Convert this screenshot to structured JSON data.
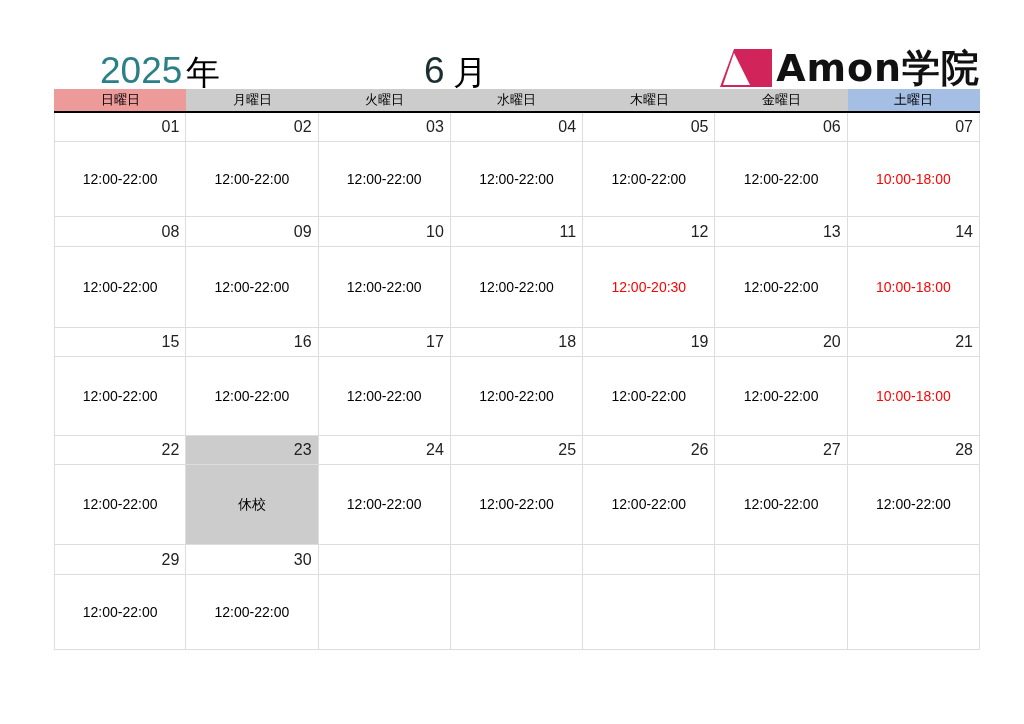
{
  "title": {
    "year": "2025",
    "year_unit": "年",
    "month": "6",
    "month_unit": "月"
  },
  "logo": {
    "text": "Amon学院"
  },
  "weekdays": [
    {
      "label": "日曜日",
      "color": "#ec9a9a"
    },
    {
      "label": "月曜日",
      "color": "#cccccc"
    },
    {
      "label": "火曜日",
      "color": "#cccccc"
    },
    {
      "label": "水曜日",
      "color": "#cccccc"
    },
    {
      "label": "木曜日",
      "color": "#cccccc"
    },
    {
      "label": "金曜日",
      "color": "#cccccc"
    },
    {
      "label": "土曜日",
      "color": "#a4bee4"
    }
  ],
  "weeks": [
    [
      {
        "date": "01",
        "hours": "12:00-22:00",
        "color": "#000000",
        "closed": false
      },
      {
        "date": "02",
        "hours": "12:00-22:00",
        "color": "#000000",
        "closed": false
      },
      {
        "date": "03",
        "hours": "12:00-22:00",
        "color": "#000000",
        "closed": false
      },
      {
        "date": "04",
        "hours": "12:00-22:00",
        "color": "#000000",
        "closed": false
      },
      {
        "date": "05",
        "hours": "12:00-22:00",
        "color": "#000000",
        "closed": false
      },
      {
        "date": "06",
        "hours": "12:00-22:00",
        "color": "#000000",
        "closed": false
      },
      {
        "date": "07",
        "hours": "10:00-18:00",
        "color": "#ff0000",
        "closed": false
      }
    ],
    [
      {
        "date": "08",
        "hours": "12:00-22:00",
        "color": "#000000",
        "closed": false
      },
      {
        "date": "09",
        "hours": "12:00-22:00",
        "color": "#000000",
        "closed": false
      },
      {
        "date": "10",
        "hours": "12:00-22:00",
        "color": "#000000",
        "closed": false
      },
      {
        "date": "11",
        "hours": "12:00-22:00",
        "color": "#000000",
        "closed": false
      },
      {
        "date": "12",
        "hours": "12:00-20:30",
        "color": "#ff0000",
        "closed": false
      },
      {
        "date": "13",
        "hours": "12:00-22:00",
        "color": "#000000",
        "closed": false
      },
      {
        "date": "14",
        "hours": "10:00-18:00",
        "color": "#ff0000",
        "closed": false
      }
    ],
    [
      {
        "date": "15",
        "hours": "12:00-22:00",
        "color": "#000000",
        "closed": false
      },
      {
        "date": "16",
        "hours": "12:00-22:00",
        "color": "#000000",
        "closed": false
      },
      {
        "date": "17",
        "hours": "12:00-22:00",
        "color": "#000000",
        "closed": false
      },
      {
        "date": "18",
        "hours": "12:00-22:00",
        "color": "#000000",
        "closed": false
      },
      {
        "date": "19",
        "hours": "12:00-22:00",
        "color": "#000000",
        "closed": false
      },
      {
        "date": "20",
        "hours": "12:00-22:00",
        "color": "#000000",
        "closed": false
      },
      {
        "date": "21",
        "hours": "10:00-18:00",
        "color": "#ff0000",
        "closed": false
      }
    ],
    [
      {
        "date": "22",
        "hours": "12:00-22:00",
        "color": "#000000",
        "closed": false
      },
      {
        "date": "23",
        "hours": "休校",
        "color": "#000000",
        "closed": true
      },
      {
        "date": "24",
        "hours": "12:00-22:00",
        "color": "#000000",
        "closed": false
      },
      {
        "date": "25",
        "hours": "12:00-22:00",
        "color": "#000000",
        "closed": false
      },
      {
        "date": "26",
        "hours": "12:00-22:00",
        "color": "#000000",
        "closed": false
      },
      {
        "date": "27",
        "hours": "12:00-22:00",
        "color": "#000000",
        "closed": false
      },
      {
        "date": "28",
        "hours": "12:00-22:00",
        "color": "#000000",
        "closed": false
      }
    ],
    [
      {
        "date": "29",
        "hours": "12:00-22:00",
        "color": "#000000",
        "closed": false
      },
      {
        "date": "30",
        "hours": "12:00-22:00",
        "color": "#000000",
        "closed": false
      }
    ]
  ]
}
